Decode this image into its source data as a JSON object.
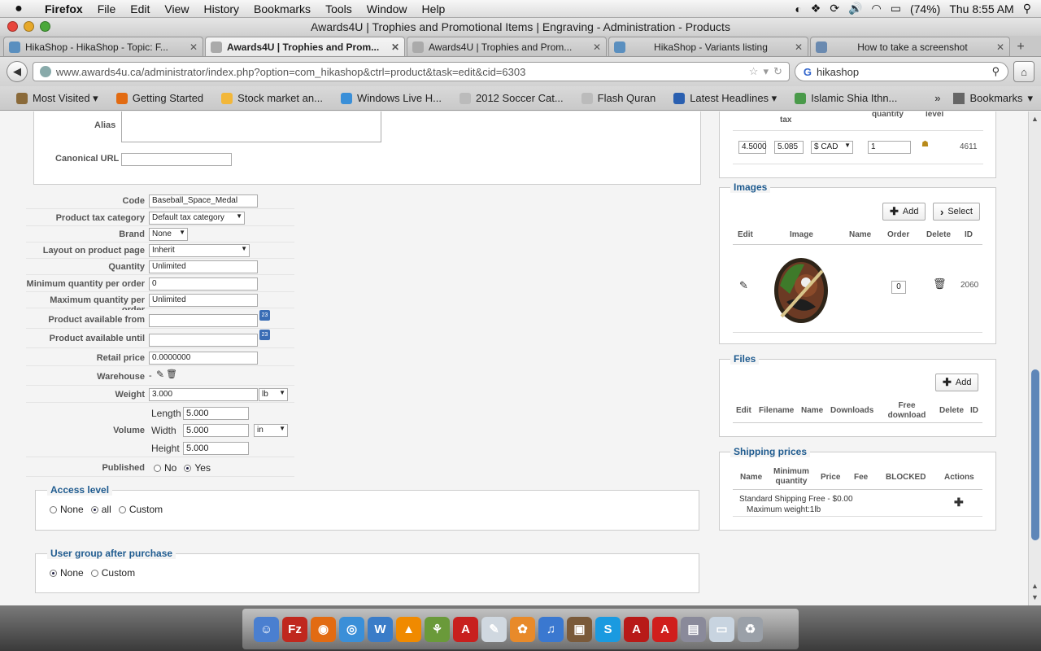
{
  "menubar": {
    "apple": "",
    "app": "Firefox",
    "items": [
      "File",
      "Edit",
      "View",
      "History",
      "Bookmarks",
      "Tools",
      "Window",
      "Help"
    ],
    "battery": "(74%)",
    "clock": "Thu 8:55 AM"
  },
  "window": {
    "title": "Awards4U | Trophies and Promotional Items | Engraving - Administration - Products"
  },
  "tabs": [
    {
      "label": "HikaShop - HikaShop - Topic: F..."
    },
    {
      "label": "Awards4U | Trophies and Prom..."
    },
    {
      "label": "Awards4U | Trophies and Prom..."
    },
    {
      "label": "HikaShop - Variants listing"
    },
    {
      "label": "How to take a screenshot"
    }
  ],
  "nav": {
    "url": "www.awards4u.ca/administrator/index.php?option=com_hikashop&ctrl=product&task=edit&cid=6303",
    "search": "hikashop"
  },
  "bookmarks": [
    {
      "label": "Most Visited ▾",
      "color": "#8a6a3a"
    },
    {
      "label": "Getting Started",
      "color": "#e26b12"
    },
    {
      "label": "Stock market an...",
      "color": "#f2b73a"
    },
    {
      "label": "Windows Live H...",
      "color": "#3a8fd8"
    },
    {
      "label": "2012 Soccer Cat...",
      "color": "#bbbbbb"
    },
    {
      "label": "Flash Quran",
      "color": "#bbbbbb"
    },
    {
      "label": "Latest Headlines ▾",
      "color": "#2a5fb0"
    },
    {
      "label": "Islamic Shia Ithn...",
      "color": "#4a9a4a"
    }
  ],
  "bookmarks_right": "Bookmarks",
  "form": {
    "alias_label": "Alias",
    "canonical_label": "Canonical URL",
    "code_label": "Code",
    "code_value": "Baseball_Space_Medal",
    "tax_label": "Product tax category",
    "tax_value": "Default tax category",
    "brand_label": "Brand",
    "brand_value": "None",
    "layout_label": "Layout on product page",
    "layout_value": "Inherit",
    "quantity_label": "Quantity",
    "quantity_value": "Unlimited",
    "minq_label": "Minimum quantity per order",
    "minq_value": "0",
    "maxq_label": "Maximum quantity per order",
    "maxq_value": "Unlimited",
    "from_label": "Product available from",
    "until_label": "Product available until",
    "retail_label": "Retail price",
    "retail_value": "0.0000000",
    "warehouse_label": "Warehouse",
    "warehouse_value": "-",
    "weight_label": "Weight",
    "weight_value": "3.000",
    "weight_unit": "lb",
    "volume_label": "Volume",
    "length_label": "Length",
    "length_value": "5.000",
    "width_label": "Width",
    "width_value": "5.000",
    "volume_unit": "in",
    "height_label": "Height",
    "height_value": "5.000",
    "published_label": "Published",
    "published_no": "No",
    "published_yes": "Yes"
  },
  "access": {
    "legend": "Access level",
    "none": "None",
    "all": "all",
    "custom": "Custom"
  },
  "usergroup": {
    "legend": "User group after purchase",
    "none": "None",
    "custom": "Custom"
  },
  "prices": {
    "headers": [
      "tax",
      "quantity",
      "level"
    ],
    "price": "4.5000",
    "with_tax": "5.085",
    "currency": "$ CAD",
    "min_qty": "1",
    "id": "4611"
  },
  "images": {
    "legend": "Images",
    "add": "Add",
    "select": "Select",
    "headers": [
      "Edit",
      "Image",
      "Name",
      "Order",
      "Delete",
      "ID"
    ],
    "order": "0",
    "id": "2060"
  },
  "files": {
    "legend": "Files",
    "add": "Add",
    "headers": [
      "Edit",
      "Filename",
      "Name",
      "Downloads",
      "Free download",
      "Delete",
      "ID"
    ]
  },
  "shipping": {
    "legend": "Shipping prices",
    "headers": [
      "Name",
      "Minimum quantity",
      "Price",
      "Fee",
      "BLOCKED",
      "Actions"
    ],
    "row_name": "Standard Shipping Free - $0.00",
    "row_sub": "Maximum weight:1lb"
  },
  "dock": [
    {
      "name": "finder-icon",
      "color": "#4a7fd0",
      "glyph": "☺"
    },
    {
      "name": "filezilla-icon",
      "color": "#c0281e",
      "glyph": "Fz"
    },
    {
      "name": "firefox-icon",
      "color": "#e26b12",
      "glyph": "◉"
    },
    {
      "name": "safari-icon",
      "color": "#3a8fd8",
      "glyph": "◎"
    },
    {
      "name": "word-icon",
      "color": "#3a7cc8",
      "glyph": "W"
    },
    {
      "name": "vlc-icon",
      "color": "#f08a00",
      "glyph": "▲"
    },
    {
      "name": "network-icon",
      "color": "#6a9a3a",
      "glyph": "⚘"
    },
    {
      "name": "acrobat-icon",
      "color": "#c8201e",
      "glyph": "A"
    },
    {
      "name": "mail-icon",
      "color": "#d0d8e0",
      "glyph": "✎"
    },
    {
      "name": "iphoto-icon",
      "color": "#e88a2a",
      "glyph": "✿"
    },
    {
      "name": "itunes-icon",
      "color": "#3a78d0",
      "glyph": "♫"
    },
    {
      "name": "preview-icon",
      "color": "#7a5a3a",
      "glyph": "▣"
    },
    {
      "name": "skype-icon",
      "color": "#1a9ae0",
      "glyph": "S"
    },
    {
      "name": "acrobat-pro-icon",
      "color": "#b81a18",
      "glyph": "A"
    },
    {
      "name": "acrobat-reader-icon",
      "color": "#d01e1c",
      "glyph": "A"
    },
    {
      "name": "image-capture-icon",
      "color": "#8a8a9a",
      "glyph": "▤"
    },
    {
      "name": "document-icon",
      "color": "#c8d4e0",
      "glyph": "▭"
    },
    {
      "name": "trash-icon",
      "color": "#9aa0a8",
      "glyph": "♻"
    }
  ]
}
